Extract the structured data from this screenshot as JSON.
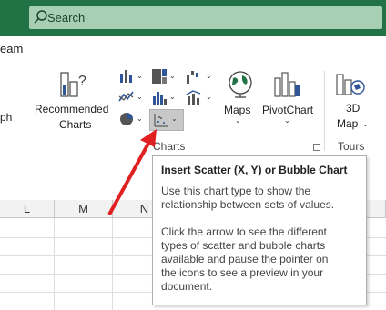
{
  "search": {
    "label": "Search"
  },
  "ribbon": {
    "left_cut_labels": [
      "eam",
      "ph"
    ],
    "recommended_charts": [
      "Recommended",
      "Charts"
    ],
    "maps": "Maps",
    "pivotchart": "PivotChart",
    "map3d": [
      "3D",
      "Map"
    ],
    "charts_group": "Charts",
    "tours_group": "Tours"
  },
  "sheet": {
    "columns": [
      "L",
      "M",
      "N"
    ]
  },
  "tooltip": {
    "title": "Insert Scatter (X, Y) or Bubble Chart",
    "line1": "Use this chart type to show the",
    "line2": "relationship between sets of values.",
    "line3": "Click the arrow to see the different",
    "line4": "types of scatter and bubble charts",
    "line5": "available and pause the pointer on",
    "line6": "the icons to see a preview in your",
    "line7": "document."
  },
  "colors": {
    "titlebar": "#217346",
    "search_bg": "#a6cfb3",
    "arrow": "#e02020"
  }
}
